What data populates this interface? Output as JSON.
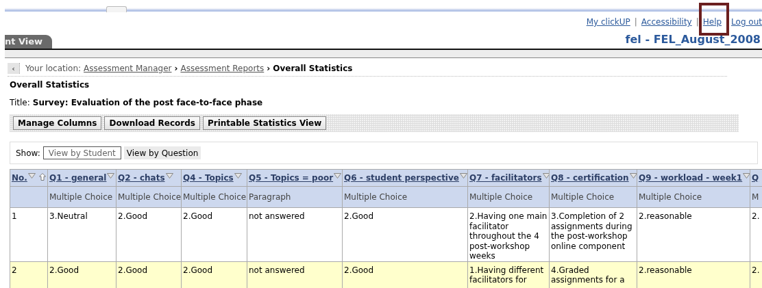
{
  "top_links": [
    {
      "label": "My clickUP",
      "highlighted": false
    },
    {
      "separator": "|",
      "label": "Accessibility",
      "highlighted": false
    },
    {
      "separator": "|",
      "label": "Help",
      "highlighted": true
    },
    {
      "label": "Log out",
      "highlighted": false
    }
  ],
  "course_title": "fel - FEL_August_2008",
  "tab": {
    "label": "nt View"
  },
  "breadcrumb": {
    "back": "‹",
    "separator": "›",
    "prefix": "Your location:",
    "links": [
      "Assessment Manager",
      "Assessment Reports"
    ],
    "current": "Overall Statistics"
  },
  "page_title": "Overall Statistics",
  "title": {
    "label": "Title:",
    "value": "Survey: Evaluation of the post face-to-face phase"
  },
  "buttons": [
    "Manage Columns",
    "Download Records",
    "Printable Statistics View"
  ],
  "show": {
    "label": "Show:",
    "options": [
      {
        "label": "View by Student",
        "selected": false
      },
      {
        "label": "View by Question",
        "selected": true
      }
    ]
  },
  "table": {
    "columns": [
      {
        "label": "No.",
        "sorted": true
      },
      {
        "label": "Q1 - general",
        "type": "Multiple Choice"
      },
      {
        "label": "Q2 - chats",
        "type": "Multiple Choice"
      },
      {
        "label": "Q4 - Topics",
        "type": "Multiple Choice"
      },
      {
        "label": "Q5 - Topics = poor",
        "type": "Paragraph"
      },
      {
        "label": "Q6 - student perspective",
        "type": "Multiple Choice"
      },
      {
        "label": "Q7 - facilitators",
        "type": "Multiple Choice"
      },
      {
        "label": "Q8 - certification",
        "type": "Multiple Choice"
      },
      {
        "label": "Q9 - workload - week1",
        "type": "Multiple Choice"
      },
      {
        "label": "Q",
        "type": "M"
      }
    ],
    "rows": [
      {
        "highlighted": false,
        "cells": [
          "1",
          "3.Neutral",
          "2.Good",
          "2.Good",
          "not answered",
          "2.Good",
          "2.Having one main facilitator throughout the 4 post-workshop weeks",
          "3.Completion of 2 assignments during the post-workshop online component",
          "2.reasonable",
          "2."
        ]
      },
      {
        "highlighted": true,
        "cells": [
          "2",
          "2.Good",
          "2.Good",
          "2.Good",
          "not answered",
          "2.Good",
          "1.Having different facilitators for",
          "4.Graded assignments for a",
          "2.reasonable",
          "2."
        ]
      }
    ]
  }
}
